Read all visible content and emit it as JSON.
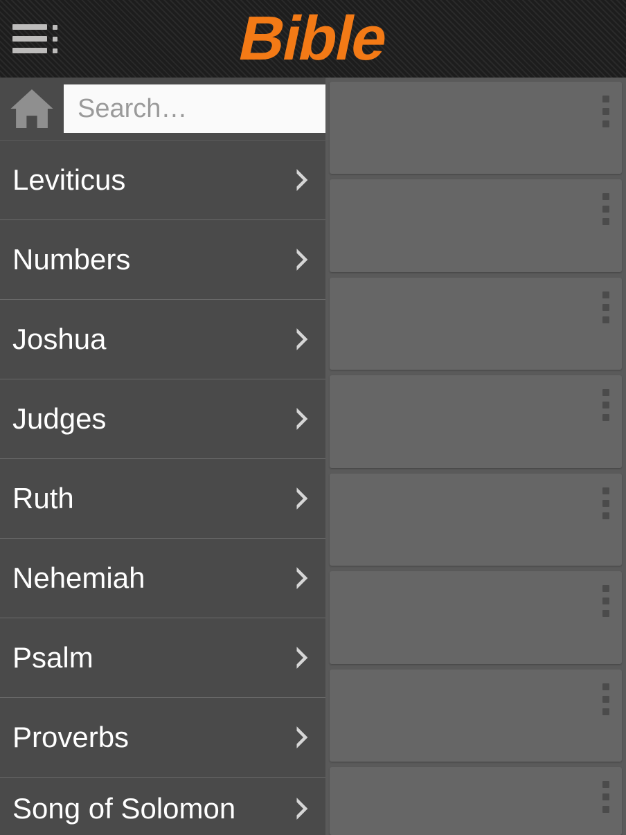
{
  "header": {
    "title": "Bible"
  },
  "search": {
    "placeholder": "Search…",
    "value": ""
  },
  "sidebar": {
    "items": [
      {
        "label": "Leviticus"
      },
      {
        "label": "Numbers"
      },
      {
        "label": "Joshua"
      },
      {
        "label": "Judges"
      },
      {
        "label": "Ruth"
      },
      {
        "label": "Nehemiah"
      },
      {
        "label": "Psalm"
      },
      {
        "label": "Proverbs"
      },
      {
        "label": "Song of Solomon"
      }
    ]
  },
  "content": {
    "card_count": 8
  },
  "colors": {
    "accent": "#f37a16",
    "header_bg": "#1d1d1d",
    "sidebar_bg": "#4a4a4a",
    "content_bg": "#5a5a5a",
    "card_bg": "#666666"
  }
}
